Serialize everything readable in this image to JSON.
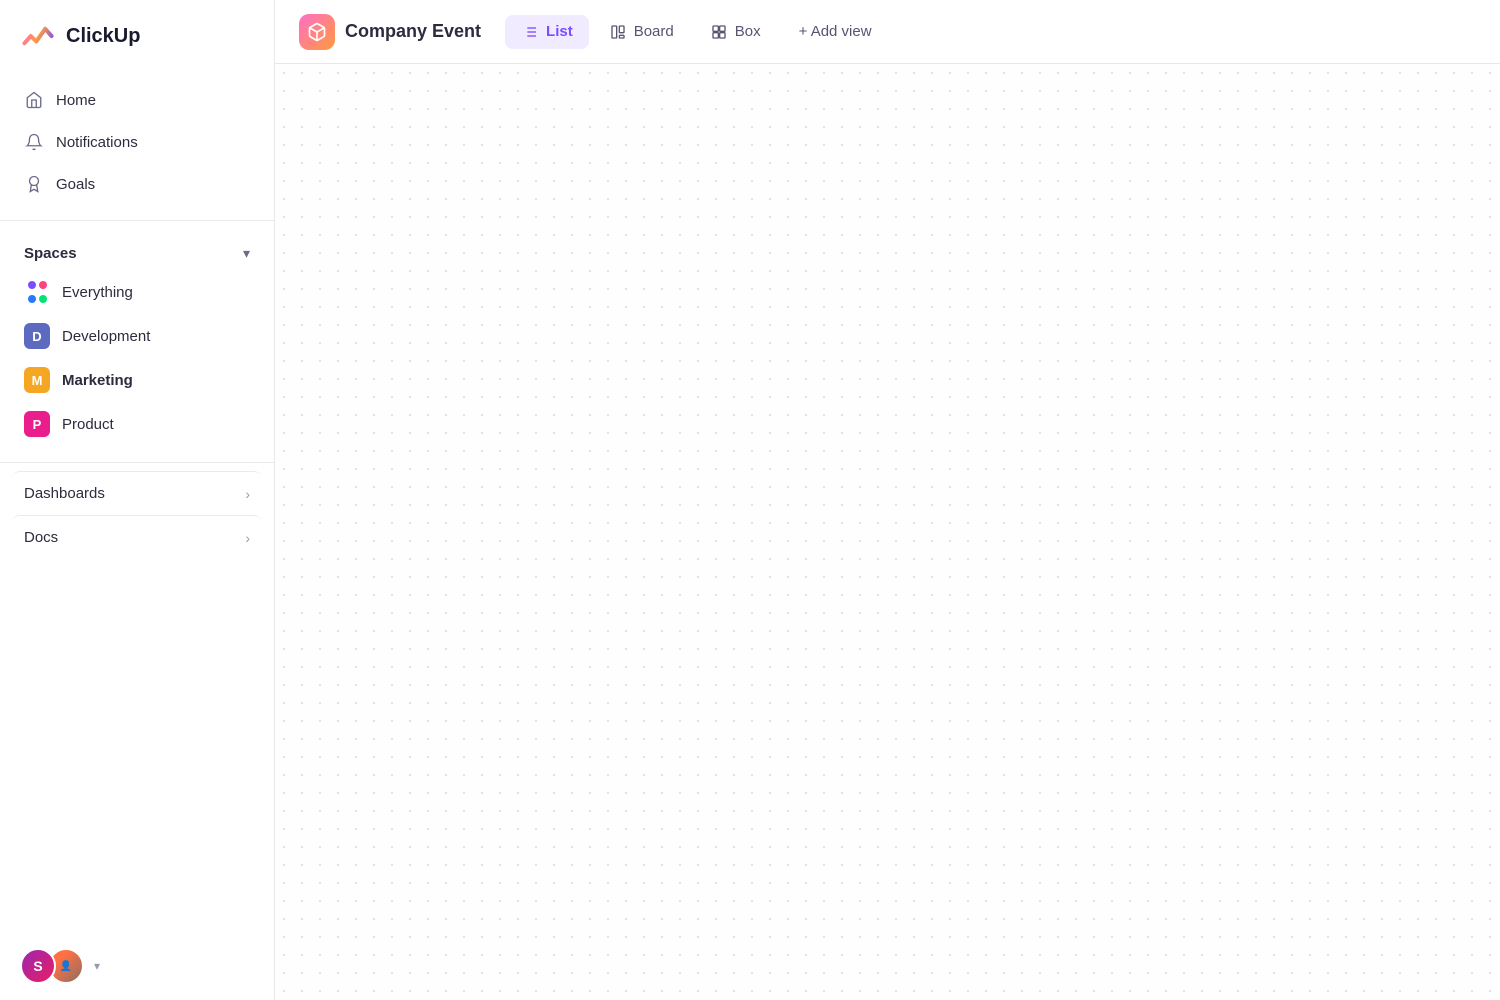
{
  "logo": {
    "text": "ClickUp"
  },
  "sidebar": {
    "nav": [
      {
        "id": "home",
        "label": "Home",
        "icon": "home-icon"
      },
      {
        "id": "notifications",
        "label": "Notifications",
        "icon": "bell-icon"
      },
      {
        "id": "goals",
        "label": "Goals",
        "icon": "trophy-icon"
      }
    ],
    "spaces": {
      "title": "Spaces",
      "items": [
        {
          "id": "everything",
          "label": "Everything",
          "type": "dots"
        },
        {
          "id": "development",
          "label": "Development",
          "type": "badge",
          "color": "blue",
          "initial": "D"
        },
        {
          "id": "marketing",
          "label": "Marketing",
          "type": "badge",
          "color": "yellow",
          "initial": "M",
          "bold": true
        },
        {
          "id": "product",
          "label": "Product",
          "type": "badge",
          "color": "pink",
          "initial": "P"
        }
      ]
    },
    "bottom": [
      {
        "id": "dashboards",
        "label": "Dashboards"
      },
      {
        "id": "docs",
        "label": "Docs"
      }
    ]
  },
  "header": {
    "project_name": "Company Event",
    "views": [
      {
        "id": "list",
        "label": "List",
        "active": true
      },
      {
        "id": "board",
        "label": "Board",
        "active": false
      },
      {
        "id": "box",
        "label": "Box",
        "active": false
      }
    ],
    "add_view_label": "+ Add view"
  },
  "footer": {
    "chevron": "▾"
  }
}
